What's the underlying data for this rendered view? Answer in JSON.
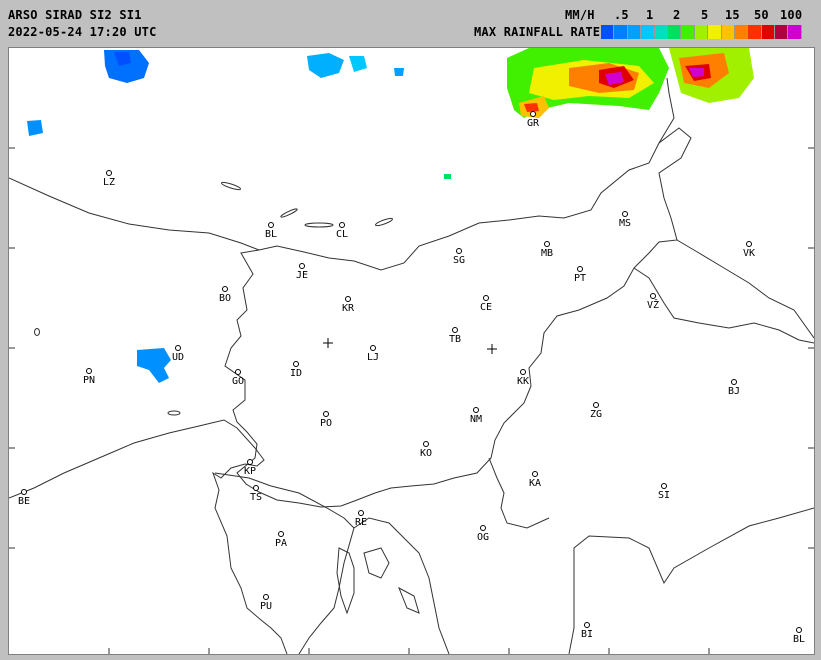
{
  "header": {
    "title": "ARSO SIRAD SI2 SI1",
    "datetime": "2022-05-24 17:20 UTC",
    "unit": "MM/H",
    "legend_title": "MAX RAINFALL RATE",
    "scale_labels": [
      ".5",
      "1",
      "2",
      "5",
      "15",
      "50",
      "100"
    ]
  },
  "legend_colors": [
    "#0050ff",
    "#0080ff",
    "#00a0ff",
    "#00c8ff",
    "#00e0c0",
    "#00e060",
    "#40f000",
    "#a0f000",
    "#f0f000",
    "#ffc000",
    "#ff8000",
    "#ff3000",
    "#e00000",
    "#b00040",
    "#d000d0"
  ],
  "cities": [
    {
      "code": "LZ"
    },
    {
      "code": "BL"
    },
    {
      "code": "CL"
    },
    {
      "code": "MS"
    },
    {
      "code": "MB"
    },
    {
      "code": "VK"
    },
    {
      "code": "SG"
    },
    {
      "code": "PT"
    },
    {
      "code": "JE"
    },
    {
      "code": "BO"
    },
    {
      "code": "KR"
    },
    {
      "code": "CE"
    },
    {
      "code": "VŽ"
    },
    {
      "code": "TB"
    },
    {
      "code": "LJ"
    },
    {
      "code": "UD"
    },
    {
      "code": "PN"
    },
    {
      "code": "GO"
    },
    {
      "code": "ID"
    },
    {
      "code": "KK"
    },
    {
      "code": "BJ"
    },
    {
      "code": "ZG"
    },
    {
      "code": "NM"
    },
    {
      "code": "PO"
    },
    {
      "code": "KO"
    },
    {
      "code": "KP"
    },
    {
      "code": "TS"
    },
    {
      "code": "KA"
    },
    {
      "code": "SI"
    },
    {
      "code": "BE"
    },
    {
      "code": "RE"
    },
    {
      "code": "PA"
    },
    {
      "code": "OG"
    },
    {
      "code": "PU"
    },
    {
      "code": "BI"
    },
    {
      "code": "BL"
    },
    {
      "code": "GR"
    }
  ]
}
